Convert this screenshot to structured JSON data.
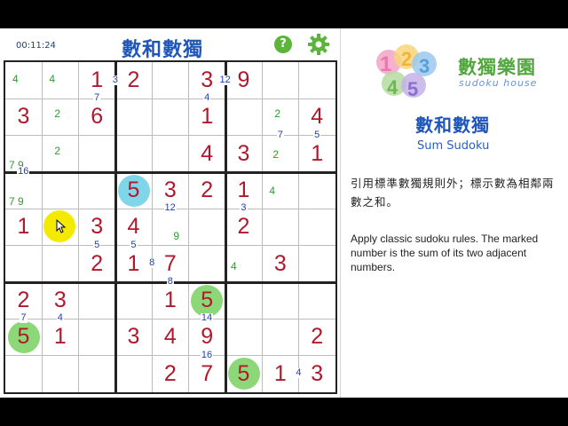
{
  "header": {
    "timer": "00:11:24",
    "title": "數和數獨",
    "help_label": "?",
    "settings_icon": "gear-icon"
  },
  "panel": {
    "logo_zh": "數獨樂園",
    "logo_en": "sudoku house",
    "title_zh": "數和數獨",
    "subtitle_en": "Sum Sudoku",
    "rules_zh": "引用標準數獨規則外；標示數為相鄰兩數之和。",
    "rules_en": "Apply classic sudoku rules. The marked number is the sum of its two adjacent numbers."
  },
  "colors": {
    "given": "#b0192c",
    "candidate": "#2f9c2f",
    "clue": "#1f3faa",
    "highlight_cyan": "#7fd6e8",
    "highlight_green": "#8cd878",
    "accent_blue": "#1f56b8"
  },
  "board": {
    "givens": [
      {
        "r": 0,
        "c": 2,
        "v": "1"
      },
      {
        "r": 0,
        "c": 3,
        "v": "2"
      },
      {
        "r": 0,
        "c": 5,
        "v": "3"
      },
      {
        "r": 0,
        "c": 6,
        "v": "9"
      },
      {
        "r": 1,
        "c": 0,
        "v": "3"
      },
      {
        "r": 1,
        "c": 2,
        "v": "6"
      },
      {
        "r": 1,
        "c": 5,
        "v": "1"
      },
      {
        "r": 1,
        "c": 8,
        "v": "4"
      },
      {
        "r": 2,
        "c": 5,
        "v": "4"
      },
      {
        "r": 2,
        "c": 6,
        "v": "3"
      },
      {
        "r": 2,
        "c": 8,
        "v": "1"
      },
      {
        "r": 3,
        "c": 3,
        "v": "5"
      },
      {
        "r": 3,
        "c": 4,
        "v": "3"
      },
      {
        "r": 3,
        "c": 5,
        "v": "2"
      },
      {
        "r": 3,
        "c": 6,
        "v": "1"
      },
      {
        "r": 4,
        "c": 0,
        "v": "1"
      },
      {
        "r": 4,
        "c": 2,
        "v": "3"
      },
      {
        "r": 4,
        "c": 3,
        "v": "4"
      },
      {
        "r": 4,
        "c": 6,
        "v": "2"
      },
      {
        "r": 5,
        "c": 2,
        "v": "2"
      },
      {
        "r": 5,
        "c": 3,
        "v": "1"
      },
      {
        "r": 5,
        "c": 4,
        "v": "7"
      },
      {
        "r": 5,
        "c": 7,
        "v": "3"
      },
      {
        "r": 6,
        "c": 0,
        "v": "2"
      },
      {
        "r": 6,
        "c": 1,
        "v": "3"
      },
      {
        "r": 6,
        "c": 4,
        "v": "1"
      },
      {
        "r": 6,
        "c": 5,
        "v": "5"
      },
      {
        "r": 7,
        "c": 0,
        "v": "5"
      },
      {
        "r": 7,
        "c": 1,
        "v": "1"
      },
      {
        "r": 7,
        "c": 3,
        "v": "3"
      },
      {
        "r": 7,
        "c": 4,
        "v": "4"
      },
      {
        "r": 7,
        "c": 5,
        "v": "9"
      },
      {
        "r": 7,
        "c": 8,
        "v": "2"
      },
      {
        "r": 8,
        "c": 4,
        "v": "2"
      },
      {
        "r": 8,
        "c": 5,
        "v": "7"
      },
      {
        "r": 8,
        "c": 6,
        "v": "5"
      },
      {
        "r": 8,
        "c": 7,
        "v": "1"
      },
      {
        "r": 8,
        "c": 8,
        "v": "3"
      }
    ],
    "candidates": [
      {
        "r": 0,
        "c": 0,
        "v": "4"
      },
      {
        "r": 0,
        "c": 1,
        "v": "4"
      },
      {
        "r": 1,
        "c": 1,
        "v": "2"
      },
      {
        "r": 1,
        "c": 7,
        "v": "2"
      },
      {
        "r": 2,
        "c": 1,
        "v": "2"
      },
      {
        "r": 2,
        "c": 7,
        "v": "2"
      },
      {
        "r": 2,
        "c": 0,
        "v": "7 9"
      },
      {
        "r": 3,
        "c": 0,
        "v": "7 9"
      },
      {
        "r": 3,
        "c": 7,
        "v": "4"
      },
      {
        "r": 4,
        "c": 4,
        "v": "9"
      },
      {
        "r": 5,
        "c": 6,
        "v": "4"
      }
    ],
    "clues": [
      {
        "id": "a",
        "v": "3"
      },
      {
        "id": "b",
        "v": "12"
      },
      {
        "id": "c",
        "v": "7"
      },
      {
        "id": "d",
        "v": "4"
      },
      {
        "id": "e",
        "v": "7"
      },
      {
        "id": "f",
        "v": "5"
      },
      {
        "id": "g",
        "v": "16"
      },
      {
        "id": "h",
        "v": "12"
      },
      {
        "id": "i",
        "v": "3"
      },
      {
        "id": "j",
        "v": "5"
      },
      {
        "id": "k",
        "v": "5"
      },
      {
        "id": "l",
        "v": "8"
      },
      {
        "id": "m",
        "v": "8"
      },
      {
        "id": "n",
        "v": "14"
      },
      {
        "id": "o",
        "v": "7"
      },
      {
        "id": "p",
        "v": "4"
      },
      {
        "id": "q",
        "v": "16"
      },
      {
        "id": "r",
        "v": "4"
      }
    ]
  }
}
